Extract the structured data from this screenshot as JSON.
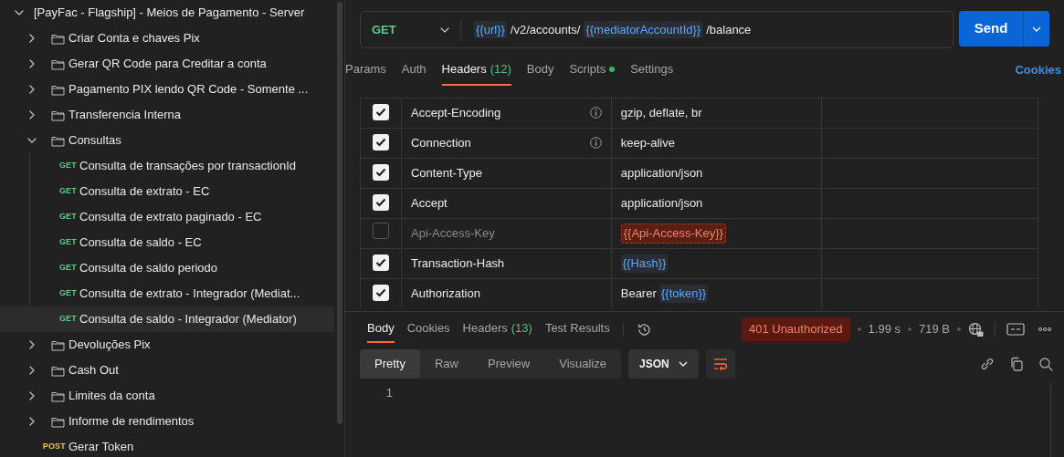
{
  "sidebar": {
    "tree": [
      {
        "kind": "collection",
        "label": "[PayFac - Flagship] - Meios de Pagamento - Server",
        "expanded": true,
        "children": [
          {
            "kind": "folder",
            "label": "Criar Conta e chaves Pix",
            "expanded": false
          },
          {
            "kind": "folder",
            "label": "Gerar QR Code para Creditar a conta",
            "expanded": false
          },
          {
            "kind": "folder",
            "label": "Pagamento PIX lendo QR Code - Somente ...",
            "expanded": false
          },
          {
            "kind": "folder",
            "label": "Transferencia Interna",
            "expanded": false
          },
          {
            "kind": "folder",
            "label": "Consultas",
            "expanded": true,
            "children": [
              {
                "kind": "request",
                "method": "GET",
                "label": "Consulta de transações por transactionId",
                "selected": false
              },
              {
                "kind": "request",
                "method": "GET",
                "label": "Consulta de extrato - EC",
                "selected": false
              },
              {
                "kind": "request",
                "method": "GET",
                "label": "Consulta de extrato paginado - EC",
                "selected": false
              },
              {
                "kind": "request",
                "method": "GET",
                "label": "Consulta de saldo - EC",
                "selected": false
              },
              {
                "kind": "request",
                "method": "GET",
                "label": "Consulta de saldo periodo",
                "selected": false
              },
              {
                "kind": "request",
                "method": "GET",
                "label": "Consulta de extrato - Integrador (Mediat...",
                "selected": false
              },
              {
                "kind": "request",
                "method": "GET",
                "label": "Consulta de saldo - Integrador (Mediator)",
                "selected": true
              }
            ]
          },
          {
            "kind": "folder",
            "label": "Devoluções Pix",
            "expanded": false
          },
          {
            "kind": "folder",
            "label": "Cash Out",
            "expanded": false
          },
          {
            "kind": "folder",
            "label": "Limites da conta",
            "expanded": false
          },
          {
            "kind": "folder",
            "label": "Informe de rendimentos",
            "expanded": false
          },
          {
            "kind": "request",
            "method": "POST",
            "label": "Gerar Token",
            "selected": false
          }
        ]
      }
    ]
  },
  "request": {
    "method": "GET",
    "url": [
      {
        "kind": "var",
        "text": "{{url}}"
      },
      {
        "kind": "text",
        "text": "/v2/accounts/"
      },
      {
        "kind": "var",
        "text": "{{mediatorAccountId}}"
      },
      {
        "kind": "text",
        "text": "/balance"
      }
    ],
    "send": "Send"
  },
  "request_tabs": [
    {
      "label": "Params",
      "selected": false
    },
    {
      "label": "Auth",
      "selected": false
    },
    {
      "label": "Headers",
      "count": "(12)",
      "selected": true
    },
    {
      "label": "Body",
      "selected": false
    },
    {
      "label": "Scripts",
      "dot": true,
      "selected": false
    },
    {
      "label": "Settings",
      "selected": false
    }
  ],
  "cookies_link": "Cookies",
  "headers": [
    {
      "checked": true,
      "key": "Accept-Encoding",
      "info": true,
      "value": [
        {
          "kind": "text",
          "text": "gzip, deflate, br"
        }
      ]
    },
    {
      "checked": true,
      "key": "Connection",
      "info": true,
      "value": [
        {
          "kind": "text",
          "text": "keep-alive"
        }
      ]
    },
    {
      "checked": true,
      "key": "Content-Type",
      "info": false,
      "value": [
        {
          "kind": "text",
          "text": "application/json"
        }
      ]
    },
    {
      "checked": true,
      "key": "Accept",
      "info": false,
      "value": [
        {
          "kind": "text",
          "text": "application/json"
        }
      ]
    },
    {
      "checked": false,
      "key": "Api-Access-Key",
      "info": false,
      "value": [
        {
          "kind": "unresolved_var",
          "text": "{{Api-Access-Key}}"
        }
      ]
    },
    {
      "checked": true,
      "key": "Transaction-Hash",
      "info": false,
      "value": [
        {
          "kind": "var",
          "text": "{{Hash}}"
        }
      ]
    },
    {
      "checked": true,
      "key": "Authorization",
      "info": false,
      "value": [
        {
          "kind": "text",
          "text": "Bearer"
        },
        {
          "kind": "var",
          "text": "{{token}}"
        }
      ]
    }
  ],
  "response": {
    "tabs": [
      {
        "label": "Body",
        "selected": true
      },
      {
        "label": "Cookies",
        "selected": false
      },
      {
        "label": "Headers",
        "count": "(13)",
        "selected": false
      },
      {
        "label": "Test Results",
        "selected": false
      }
    ],
    "status": "401 Unauthorized",
    "time": "1.99 s",
    "size": "719 B",
    "view_tabs": [
      {
        "label": "Pretty",
        "selected": true
      },
      {
        "label": "Raw",
        "selected": false
      },
      {
        "label": "Preview",
        "selected": false
      },
      {
        "label": "Visualize",
        "selected": false
      }
    ],
    "format": "JSON",
    "line_numbers": [
      "1"
    ]
  }
}
